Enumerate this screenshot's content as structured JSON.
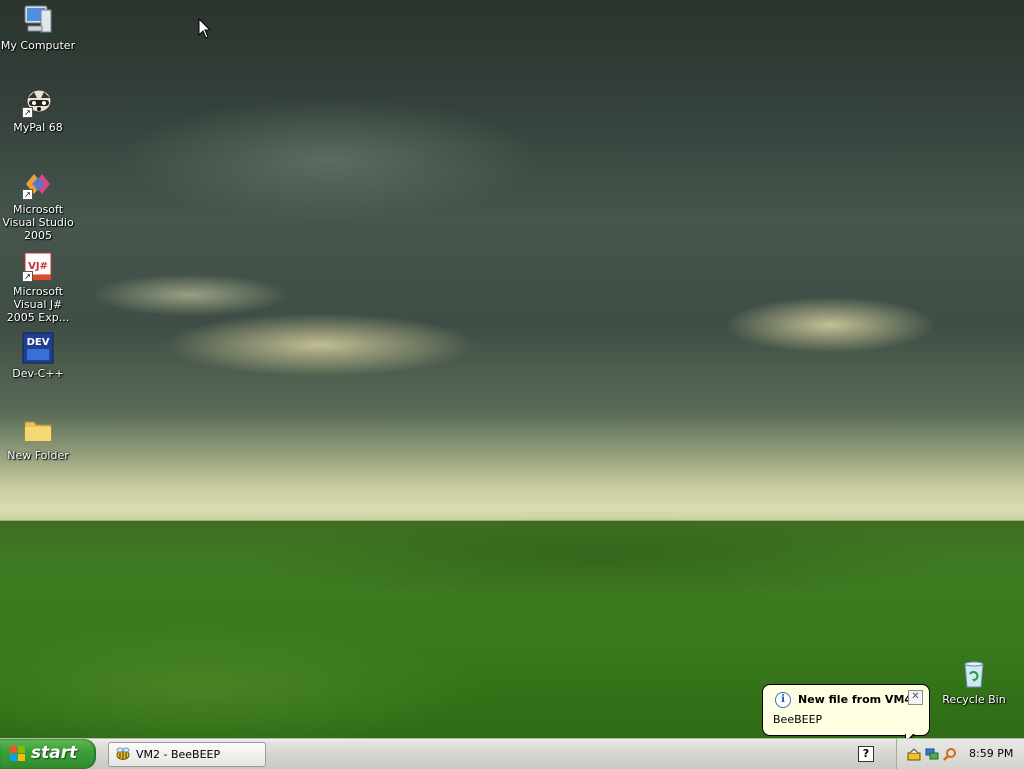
{
  "desktop": {
    "icons": [
      {
        "name": "my-computer-icon",
        "label": "My Computer",
        "shortcut": false
      },
      {
        "name": "mypal-icon",
        "label": "MyPal 68",
        "shortcut": true
      },
      {
        "name": "visual-studio-icon",
        "label": "Microsoft Visual Studio 2005",
        "shortcut": true
      },
      {
        "name": "visual-jsharp-icon",
        "label": "Microsoft Visual J# 2005 Exp...",
        "shortcut": true
      },
      {
        "name": "dev-cpp-icon",
        "label": "Dev-C++",
        "shortcut": false
      },
      {
        "name": "folder-icon",
        "label": "New Folder",
        "shortcut": false
      },
      {
        "name": "recycle-bin-icon",
        "label": "Recycle Bin",
        "shortcut": false
      }
    ],
    "icon_glyph_text": {
      "vjsharp": "VJ#",
      "dev": "DEV"
    }
  },
  "balloon": {
    "title": "New file from VM4",
    "body": "BeeBEEP",
    "close": "✕",
    "info": "i"
  },
  "taskbar": {
    "start_label": "start",
    "window_button": "VM2 - BeeBEEP",
    "help_icon_text": "?",
    "clock": "8:59 PM"
  },
  "colors": {
    "start_green": "#3c9f3a",
    "balloon_bg": "#ffffe1",
    "taskbar_bg": "#d6d6d1"
  }
}
